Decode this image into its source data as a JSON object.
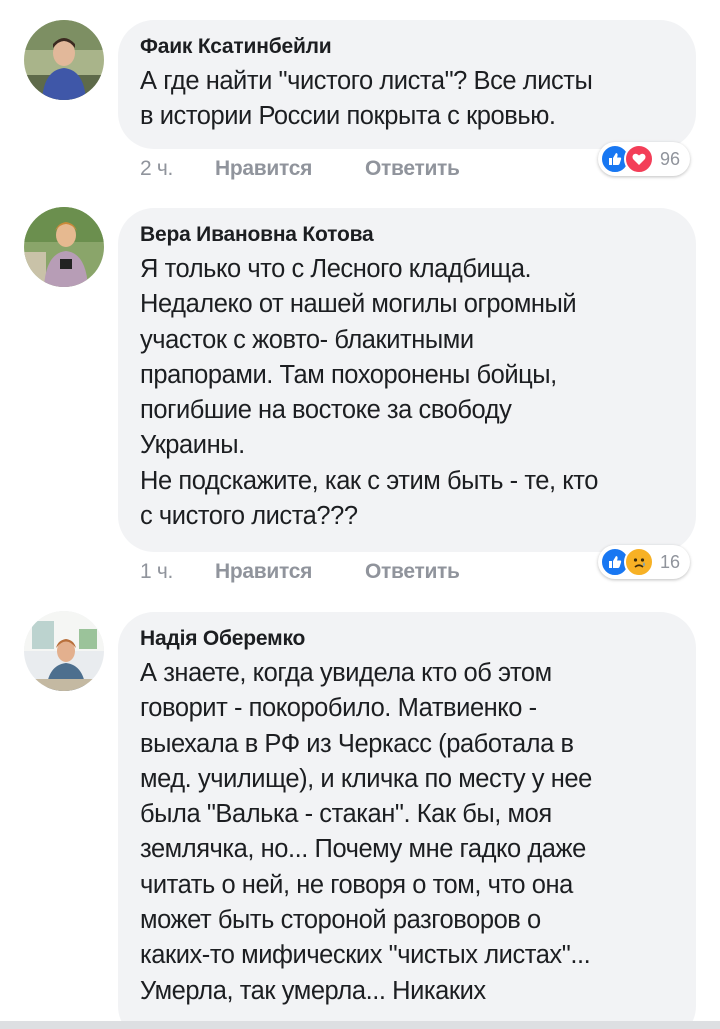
{
  "comments": [
    {
      "author": "Фаик Ксатинбейли",
      "text": "А где найти \"чистого листа\"? Все листы\nв истории России покрыта с кровью.",
      "time": "2 ч.",
      "like_label": "Нравится",
      "reply_label": "Ответить",
      "reactions": [
        "like-icon",
        "love-icon"
      ],
      "reaction_count": "96"
    },
    {
      "author": "Вера Ивановна Котова",
      "text": "Я только что с Лесного кладбища.\nНедалеко от нашей могилы огромный\nучасток с жовто- блакитными\nпрапорами. Там похоронены бойцы,\nпогибшие на востоке за свободу\nУкраины.\nНе подскажите, как с этим быть - те, кто\nс чистого листа???",
      "time": "1 ч.",
      "like_label": "Нравится",
      "reply_label": "Ответить",
      "reactions": [
        "like-icon",
        "sad-icon"
      ],
      "reaction_count": "16"
    },
    {
      "author": "Надія Оберемко",
      "text": "А знаете, когда увидела кто об этом\nговорит - покоробило. Матвиенко -\nвыехала в РФ из Черкасс (работала в\nмед. училище), и кличка по месту у нее\nбыла \"Валька - стакан\". Как бы, моя\nземлячка, но... Почему мне гадко даже\nчитать о ней, не говоря о том, что она\nможет быть стороной разговоров о\nкаких-то мифических \"чистых листах\"...\nУмерла, так умерла... Никаких"
    }
  ],
  "colors": {
    "like": "#1877f2",
    "love": "#f33e58",
    "sad": "#f7b125",
    "bubble": "#f2f3f5",
    "meta": "#90949c"
  }
}
